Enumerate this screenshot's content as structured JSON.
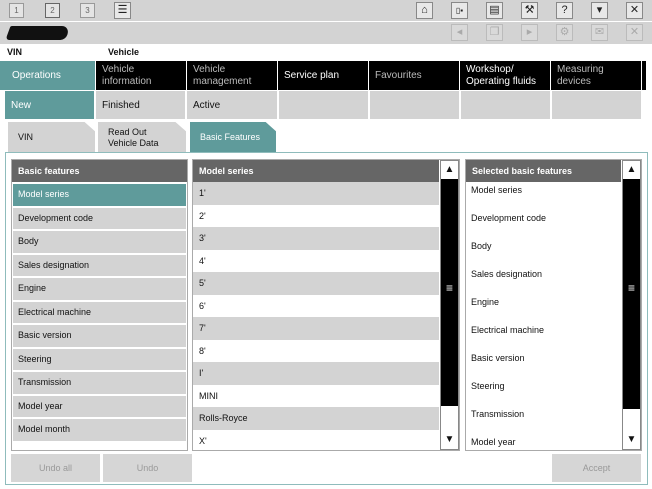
{
  "toolbar": {
    "page_buttons": [
      "1",
      "2",
      "3"
    ],
    "icons": [
      "home-icon",
      "display-icon",
      "printer-icon",
      "wrench-icon",
      "help-icon",
      "window-icon",
      "close-icon"
    ],
    "help_glyph": "?"
  },
  "toolbar2": {
    "icons": [
      "back-icon",
      "copy-icon",
      "forward-icon",
      "gear-icon",
      "mail-icon",
      "close-icon"
    ]
  },
  "info": {
    "vin_label": "VIN",
    "vehicle_label": "Vehicle"
  },
  "main_nav": [
    "Operations",
    "Vehicle information",
    "Vehicle management",
    "Service plan",
    "Favourites",
    "Workshop/ Operating fluids",
    "Measuring devices"
  ],
  "sub_nav": [
    "New",
    "Finished",
    "Active"
  ],
  "tabs": [
    "VIN",
    "Read Out Vehicle Data",
    "Basic Features"
  ],
  "basic_features": {
    "header": "Basic features",
    "items": [
      "Model series",
      "Development code",
      "Body",
      "Sales designation",
      "Engine",
      "Electrical machine",
      "Basic version",
      "Steering",
      "Transmission",
      "Model year",
      "Model month"
    ],
    "selected": "Model series"
  },
  "model_series": {
    "header": "Model series",
    "items": [
      "1'",
      "2'",
      "3'",
      "4'",
      "5'",
      "6'",
      "7'",
      "8'",
      "I'",
      "MINI",
      "Rolls-Royce",
      "X'"
    ]
  },
  "selected_features": {
    "header": "Selected basic features",
    "items": [
      "Model series",
      "Development code",
      "Body",
      "Sales designation",
      "Engine",
      "Electrical machine",
      "Basic version",
      "Steering",
      "Transmission",
      "Model year"
    ]
  },
  "buttons": {
    "undo_all": "Undo all",
    "undo": "Undo",
    "accept": "Accept"
  },
  "colors": {
    "accent": "#5f9b9b",
    "nav_bg": "#000000",
    "panel_header": "#666666"
  }
}
